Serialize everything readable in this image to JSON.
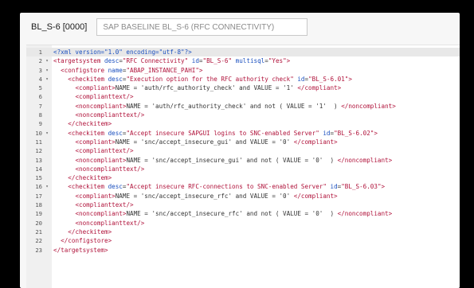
{
  "header": {
    "object_id": "BL_S-6 [0000]",
    "description": "SAP BASELINE BL_S-6 (RFC CONNECTIVITY)"
  },
  "editor": {
    "language": "xml",
    "active_line": 1,
    "lines": [
      {
        "n": "1",
        "fold": false,
        "indent": 0,
        "tokens": [
          [
            "pi",
            "<?xml version=\"1.0\" encoding=\"utf-8\"?>"
          ]
        ]
      },
      {
        "n": "2",
        "fold": true,
        "indent": 0,
        "tokens": [
          [
            "tag",
            "<targetsystem "
          ],
          [
            "attr",
            "desc"
          ],
          [
            "eq",
            "="
          ],
          [
            "str",
            "\"RFC Connectivity\" "
          ],
          [
            "attr",
            "id"
          ],
          [
            "eq",
            "="
          ],
          [
            "str",
            "\"BL_S-6\" "
          ],
          [
            "attr",
            "multisql"
          ],
          [
            "eq",
            "="
          ],
          [
            "str",
            "\"Yes\""
          ],
          [
            "tag",
            ">"
          ]
        ]
      },
      {
        "n": "3",
        "fold": true,
        "indent": 1,
        "tokens": [
          [
            "tag",
            "<configstore "
          ],
          [
            "attr",
            "name"
          ],
          [
            "eq",
            "="
          ],
          [
            "str",
            "\"ABAP_INSTANCE_PAHI\""
          ],
          [
            "tag",
            ">"
          ]
        ]
      },
      {
        "n": "4",
        "fold": true,
        "indent": 2,
        "tokens": [
          [
            "tag",
            "<checkitem "
          ],
          [
            "attr",
            "desc"
          ],
          [
            "eq",
            "="
          ],
          [
            "str",
            "\"Execution option for the RFC authority check\" "
          ],
          [
            "attr",
            "id"
          ],
          [
            "eq",
            "="
          ],
          [
            "str",
            "\"BL_S-6.01\""
          ],
          [
            "tag",
            ">"
          ]
        ]
      },
      {
        "n": "5",
        "fold": false,
        "indent": 3,
        "tokens": [
          [
            "tag",
            "<compliant>"
          ],
          [
            "text",
            "NAME = 'auth/rfc_authority_check' and VALUE = '1' "
          ],
          [
            "tag",
            "</compliant>"
          ]
        ]
      },
      {
        "n": "6",
        "fold": false,
        "indent": 3,
        "tokens": [
          [
            "tag",
            "<complianttext/>"
          ]
        ]
      },
      {
        "n": "7",
        "fold": false,
        "indent": 3,
        "tokens": [
          [
            "tag",
            "<noncompliant>"
          ],
          [
            "text",
            "NAME = 'auth/rfc_authority_check' and not ( VALUE = '1'  ) "
          ],
          [
            "tag",
            "</noncompliant>"
          ]
        ]
      },
      {
        "n": "8",
        "fold": false,
        "indent": 3,
        "tokens": [
          [
            "tag",
            "<noncomplianttext/>"
          ]
        ]
      },
      {
        "n": "9",
        "fold": false,
        "indent": 2,
        "tokens": [
          [
            "tag",
            "</checkitem>"
          ]
        ]
      },
      {
        "n": "10",
        "fold": true,
        "indent": 2,
        "tokens": [
          [
            "tag",
            "<checkitem "
          ],
          [
            "attr",
            "desc"
          ],
          [
            "eq",
            "="
          ],
          [
            "str",
            "\"Accept insecure SAPGUI logins to SNC-enabled Server\" "
          ],
          [
            "attr",
            "id"
          ],
          [
            "eq",
            "="
          ],
          [
            "str",
            "\"BL_S-6.02\""
          ],
          [
            "tag",
            ">"
          ]
        ]
      },
      {
        "n": "11",
        "fold": false,
        "indent": 3,
        "tokens": [
          [
            "tag",
            "<compliant>"
          ],
          [
            "text",
            "NAME = 'snc/accept_insecure_gui' and VALUE = '0' "
          ],
          [
            "tag",
            "</compliant>"
          ]
        ]
      },
      {
        "n": "12",
        "fold": false,
        "indent": 3,
        "tokens": [
          [
            "tag",
            "<complianttext/>"
          ]
        ]
      },
      {
        "n": "13",
        "fold": false,
        "indent": 3,
        "tokens": [
          [
            "tag",
            "<noncompliant>"
          ],
          [
            "text",
            "NAME = 'snc/accept_insecure_gui' and not ( VALUE = '0'  ) "
          ],
          [
            "tag",
            "</noncompliant>"
          ]
        ]
      },
      {
        "n": "14",
        "fold": false,
        "indent": 3,
        "tokens": [
          [
            "tag",
            "<noncomplianttext/>"
          ]
        ]
      },
      {
        "n": "15",
        "fold": false,
        "indent": 2,
        "tokens": [
          [
            "tag",
            "</checkitem>"
          ]
        ]
      },
      {
        "n": "16",
        "fold": true,
        "indent": 2,
        "tokens": [
          [
            "tag",
            "<checkitem "
          ],
          [
            "attr",
            "desc"
          ],
          [
            "eq",
            "="
          ],
          [
            "str",
            "\"Accept insecure RFC-connections to SNC-enabled Server\" "
          ],
          [
            "attr",
            "id"
          ],
          [
            "eq",
            "="
          ],
          [
            "str",
            "\"BL_S-6.03\""
          ],
          [
            "tag",
            ">"
          ]
        ]
      },
      {
        "n": "17",
        "fold": false,
        "indent": 3,
        "tokens": [
          [
            "tag",
            "<compliant>"
          ],
          [
            "text",
            "NAME = 'snc/accept_insecure_rfc' and VALUE = '0' "
          ],
          [
            "tag",
            "</compliant>"
          ]
        ]
      },
      {
        "n": "18",
        "fold": false,
        "indent": 3,
        "tokens": [
          [
            "tag",
            "<complianttext/>"
          ]
        ]
      },
      {
        "n": "19",
        "fold": false,
        "indent": 3,
        "tokens": [
          [
            "tag",
            "<noncompliant>"
          ],
          [
            "text",
            "NAME = 'snc/accept_insecure_rfc' and not ( VALUE = '0'  ) "
          ],
          [
            "tag",
            "</noncompliant>"
          ]
        ]
      },
      {
        "n": "20",
        "fold": false,
        "indent": 3,
        "tokens": [
          [
            "tag",
            "<noncomplianttext/>"
          ]
        ]
      },
      {
        "n": "21",
        "fold": false,
        "indent": 2,
        "tokens": [
          [
            "tag",
            "</checkitem>"
          ]
        ]
      },
      {
        "n": "22",
        "fold": false,
        "indent": 1,
        "tokens": [
          [
            "tag",
            "</configstore>"
          ]
        ]
      },
      {
        "n": "23",
        "fold": false,
        "indent": 0,
        "tokens": [
          [
            "tag",
            "</targetsystem>"
          ]
        ]
      }
    ]
  }
}
